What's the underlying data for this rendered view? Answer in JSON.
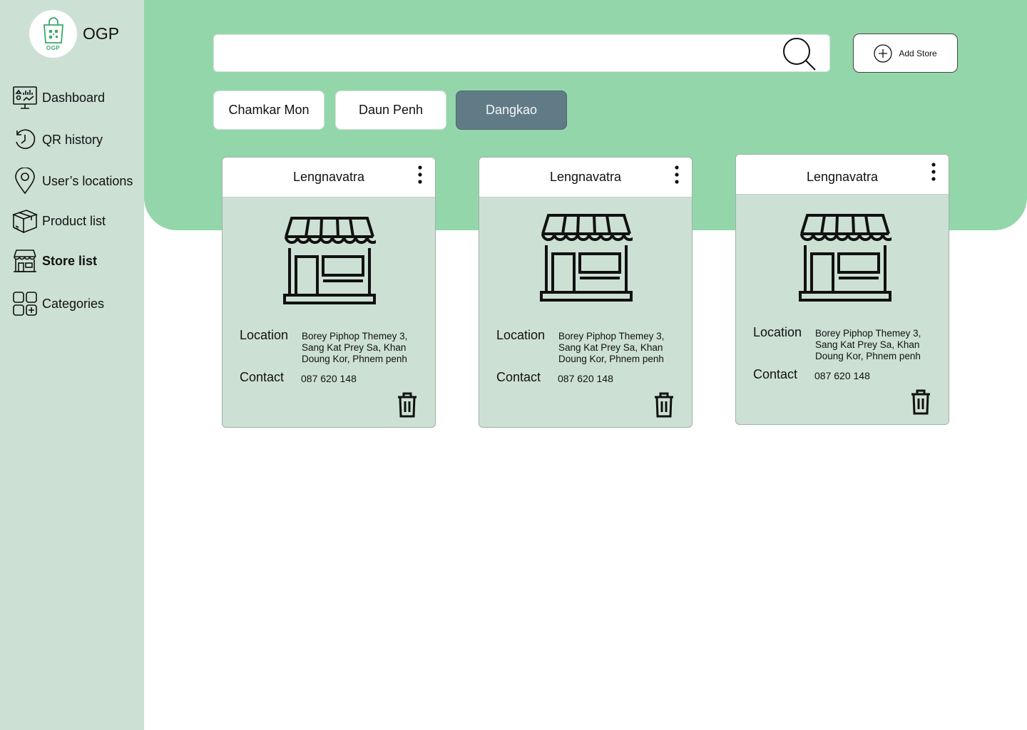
{
  "app": {
    "logo_text": "OGP",
    "name": "OGP"
  },
  "sidebar": {
    "items": [
      {
        "label": "Dashboard",
        "icon": "dashboard-icon"
      },
      {
        "label": "QR history",
        "icon": "history-icon"
      },
      {
        "label": "User’s locations",
        "icon": "location-pin-icon"
      },
      {
        "label": "Product list",
        "icon": "box-icon"
      },
      {
        "label": "Store list",
        "icon": "store-icon",
        "active": true
      },
      {
        "label": "Categories",
        "icon": "categories-grid-icon"
      }
    ]
  },
  "search": {
    "placeholder": "",
    "value": "",
    "icon": "search-icon"
  },
  "add_store": {
    "label": "Add Store",
    "icon": "plus-circle-icon"
  },
  "tabs": [
    {
      "label": "Chamkar Mon"
    },
    {
      "label": "Daun Penh"
    },
    {
      "label": "Dangkao",
      "active": true
    }
  ],
  "stores": [
    {
      "name": "Lengnavatra",
      "location_label": "Location",
      "location": "Borey Piphop Themey 3, Sang Kat Prey Sa, Khan Doung Kor, Phnem penh",
      "contact_label": "Contact",
      "contact": "087 620 148"
    },
    {
      "name": "Lengnavatra",
      "location_label": "Location",
      "location": "Borey Piphop Themey 3, Sang Kat Prey Sa, Khan Doung Kor, Phnem penh",
      "contact_label": "Contact",
      "contact": "087 620 148"
    },
    {
      "name": "Lengnavatra",
      "location_label": "Location",
      "location": "Borey Piphop Themey 3, Sang Kat Prey Sa, Khan Doung Kor, Phnem penh",
      "contact_label": "Contact",
      "contact": "087 620 148"
    }
  ],
  "colors": {
    "sidebar_bg": "#cde0d4",
    "hero_bg": "#93d6aa",
    "active_tab": "#607b85",
    "card_bg": "#cde0d4",
    "logo_green": "#39a86a"
  }
}
